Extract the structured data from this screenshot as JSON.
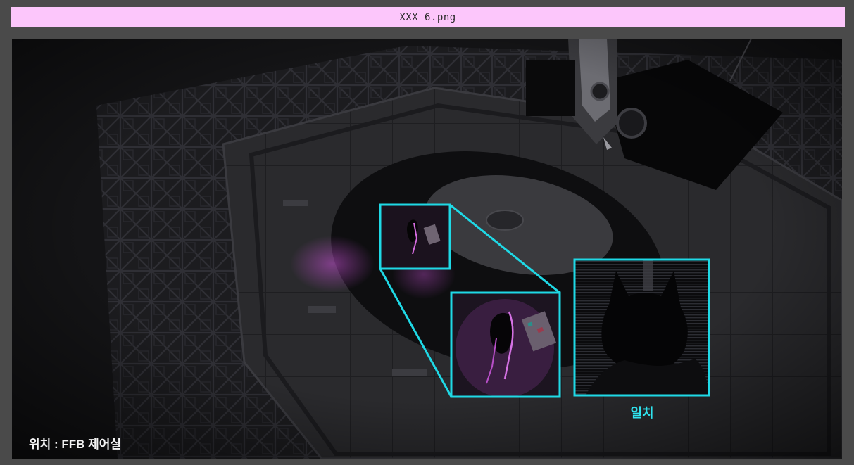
{
  "window": {
    "title": "XXX_6.png"
  },
  "viewer": {
    "location_text": "위치 : FFB 제어실",
    "match_label": "일치"
  },
  "colors": {
    "title_bar": "#fcc6fb",
    "frame": "#4a4a4a",
    "highlight": "#1fd9e6",
    "match_text": "#2fe3ee",
    "figure_glow": "#c24fd0"
  },
  "icons": {
    "source_box": "highlight-box",
    "zoom_box": "zoom-inset",
    "match_box": "match-inset"
  }
}
